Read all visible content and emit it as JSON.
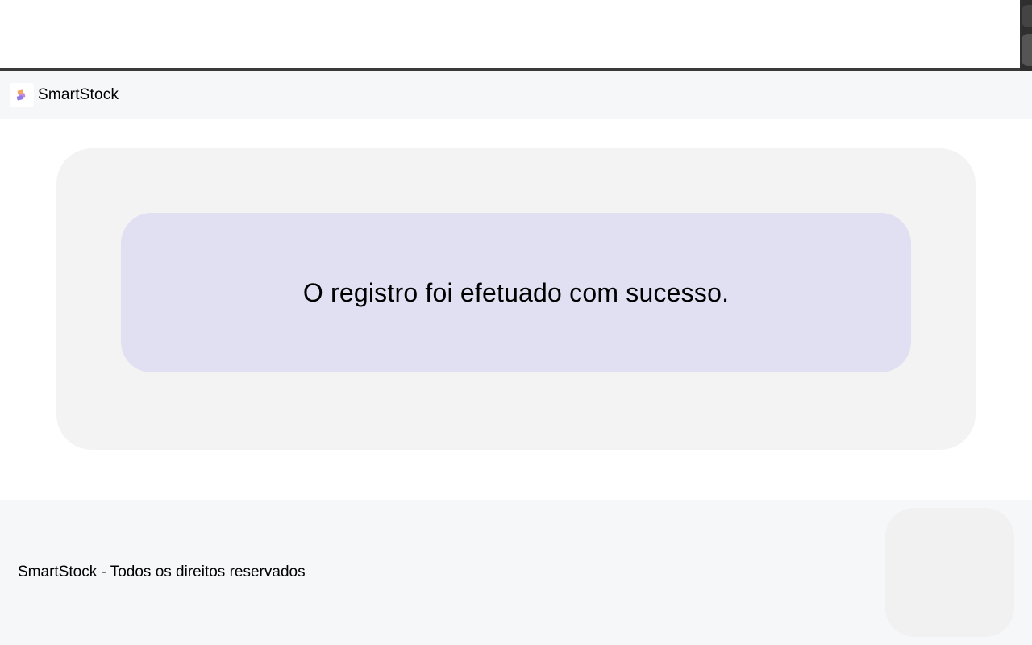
{
  "navbar": {
    "brand_name": "SmartStock",
    "logo_icon": "smartstock-logo-icon"
  },
  "main": {
    "alert_message": "O registro foi efetuado com sucesso."
  },
  "footer": {
    "copyright": "SmartStock - Todos os direitos reservados"
  },
  "colors": {
    "navbar_bg": "#f6f7f9",
    "card_bg": "#f3f3f3",
    "alert_bg": "#e1e0f2"
  }
}
